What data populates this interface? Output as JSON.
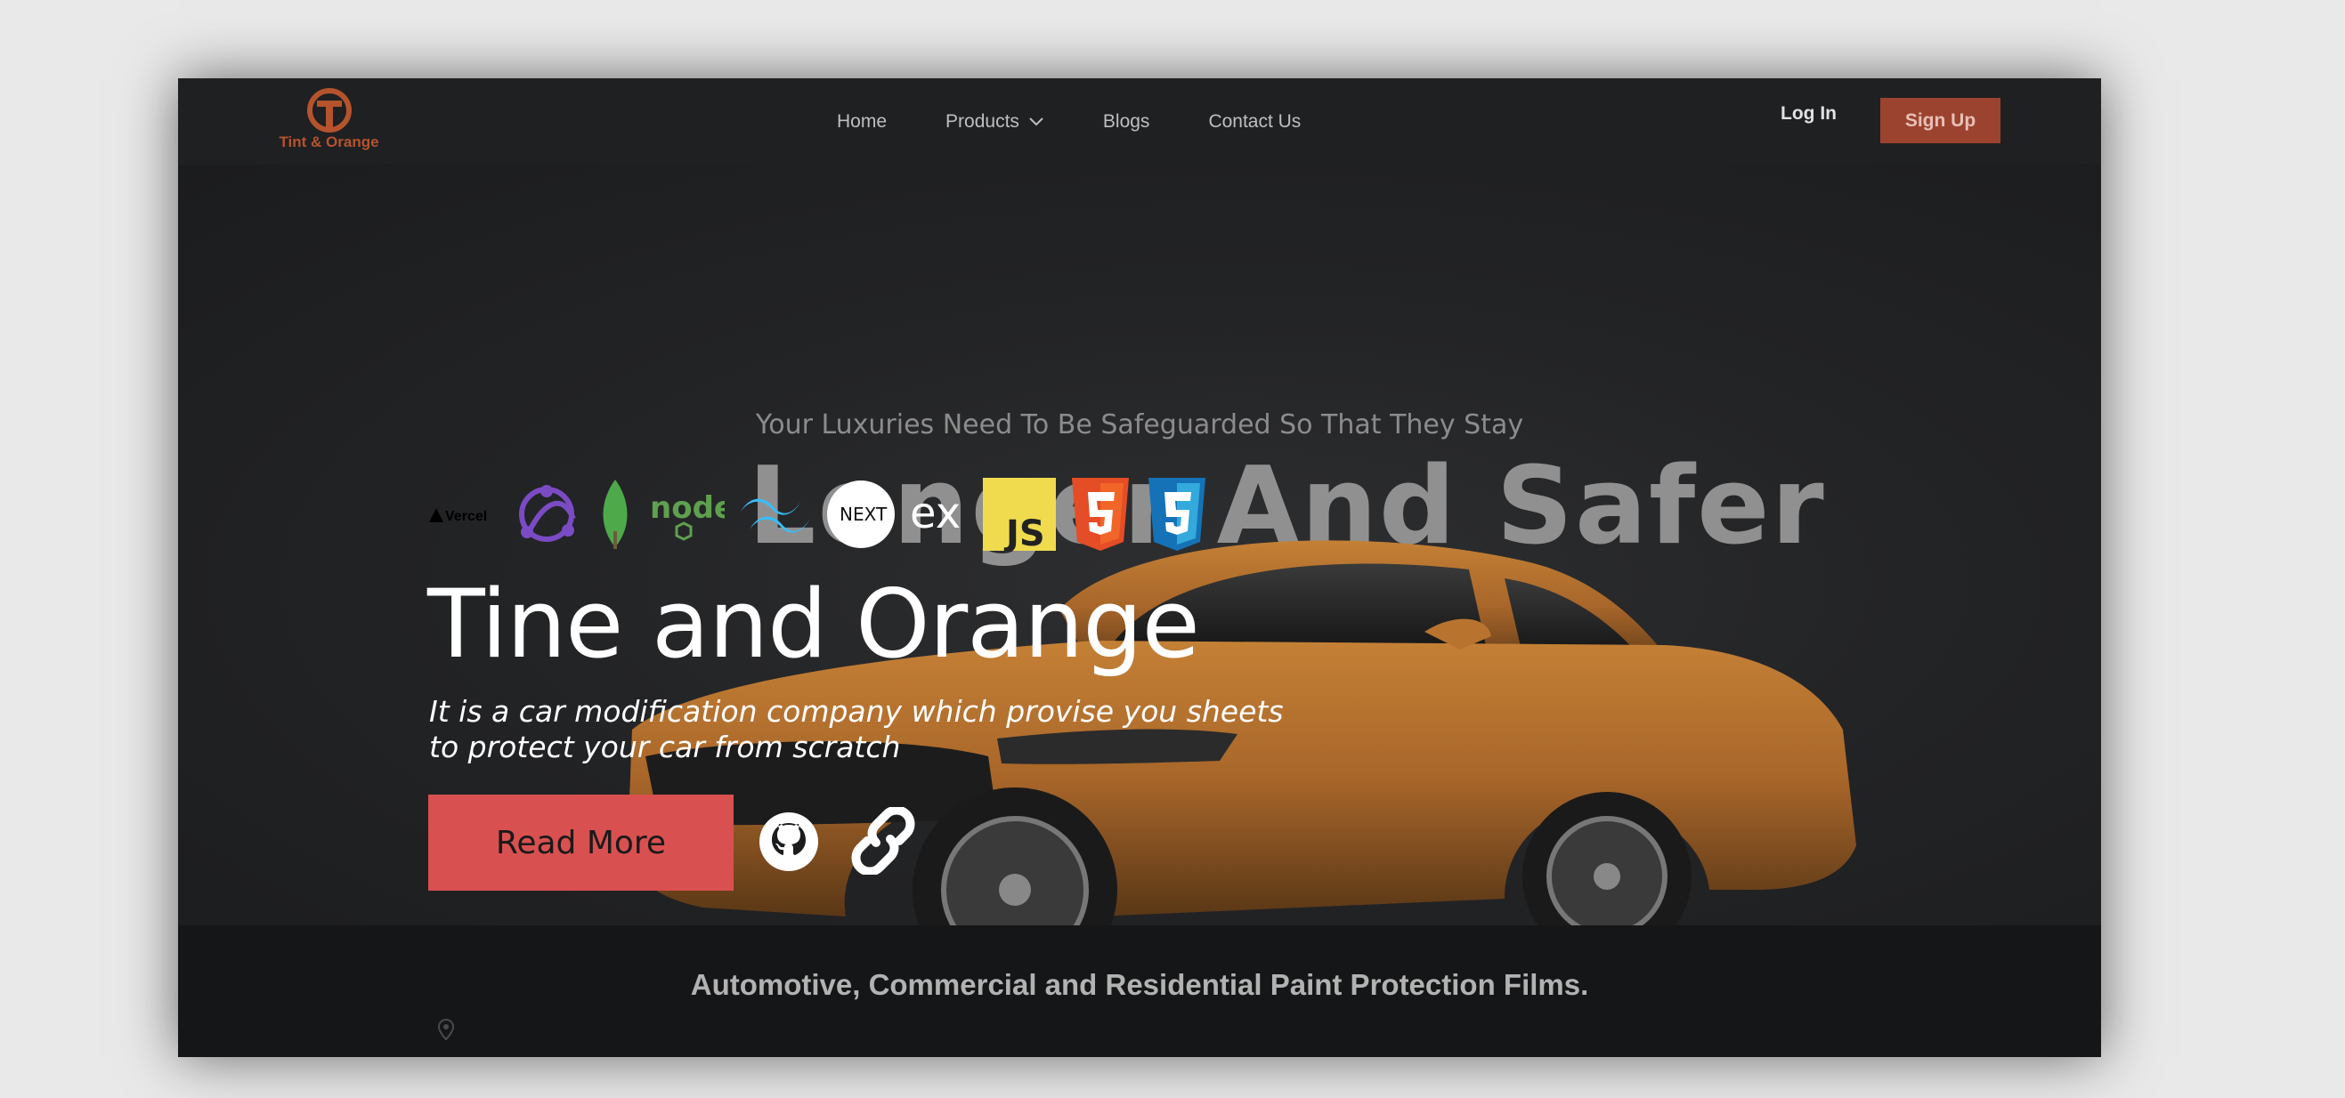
{
  "brand": {
    "name": "Tint & Orange"
  },
  "nav": {
    "links": [
      {
        "label": "Home"
      },
      {
        "label": "Products"
      },
      {
        "label": "Blogs"
      },
      {
        "label": "Contact Us"
      }
    ],
    "login_label": "Log In",
    "signup_label": "Sign Up"
  },
  "hero": {
    "tagline": "Your Luxuries Need To Be Safeguarded So That They Stay",
    "headline": "Longer And Safer"
  },
  "overlay": {
    "tech_icons": [
      "vercel-icon",
      "redux-icon",
      "mongodb-icon",
      "nodejs-icon",
      "tailwind-icon",
      "nextjs-icon",
      "express-icon",
      "javascript-icon",
      "html5-icon",
      "css3-icon"
    ],
    "tech_labels": {
      "vercel": "Vercel",
      "node": "node",
      "next": "NEXT",
      "express": "ex",
      "js": "JS"
    },
    "title": "Tine and Orange",
    "description": "It is a car modification company which provise you sheets to protect your car from scratch",
    "read_more_label": "Read More",
    "link_icons": [
      "github-icon",
      "link-icon"
    ]
  },
  "footer_band": {
    "text": "Automotive, Commercial and Residential Paint Protection Films."
  },
  "colors": {
    "accent": "#d95050",
    "brand_orange": "#b5532d",
    "signup_bg": "#9c4330",
    "page_bg": "#1b1c1e"
  }
}
